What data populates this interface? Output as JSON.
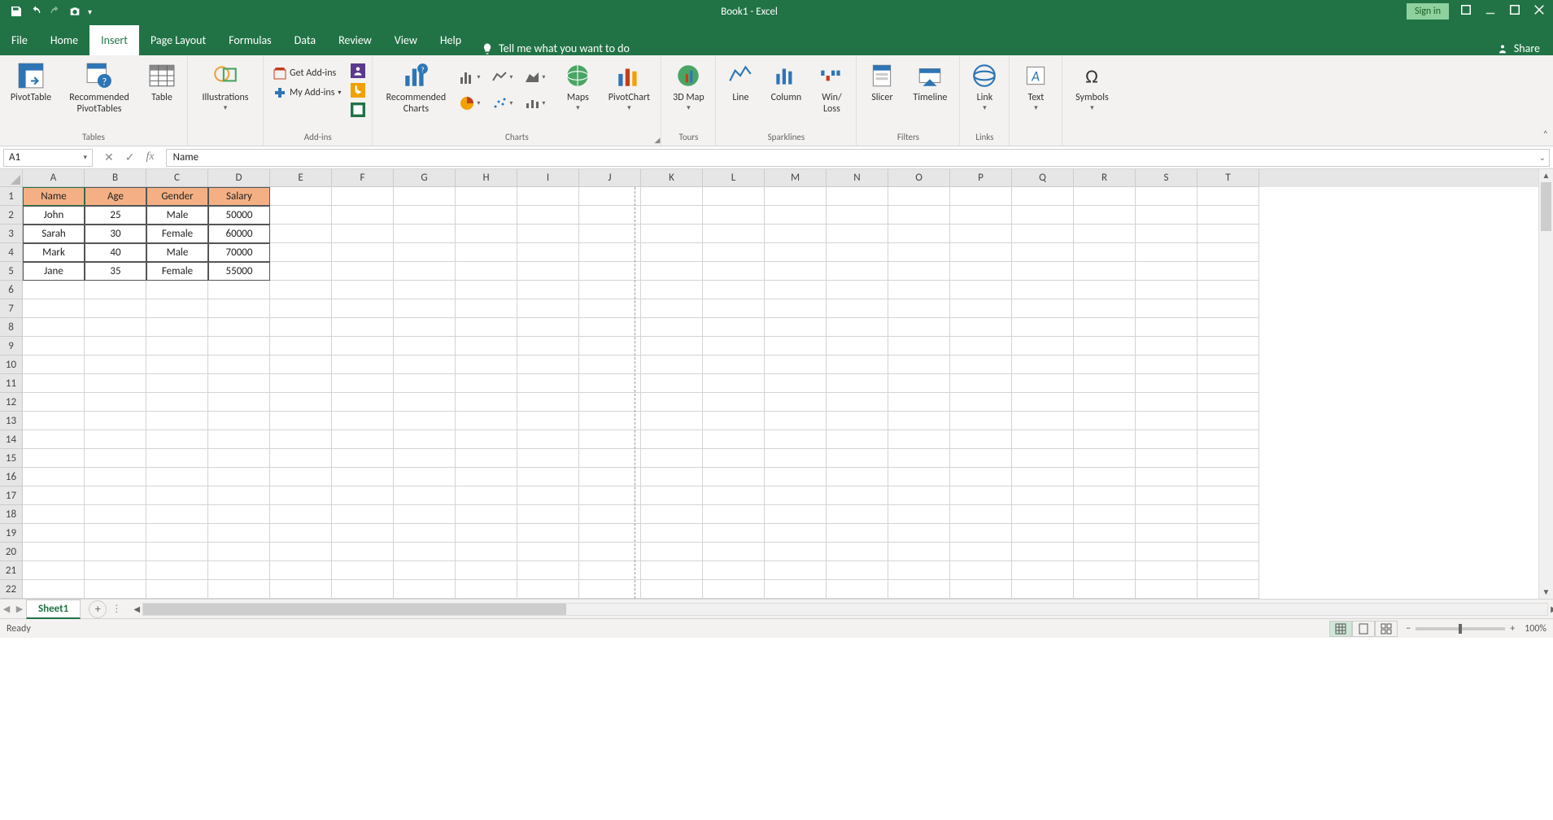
{
  "titlebar": {
    "title": "Book1  -  Excel",
    "signin": "Sign in"
  },
  "tabs": {
    "file": "File",
    "home": "Home",
    "insert": "Insert",
    "pagelayout": "Page Layout",
    "formulas": "Formulas",
    "data": "Data",
    "review": "Review",
    "view": "View",
    "help": "Help",
    "tellme": "Tell me what you want to do",
    "share": "Share"
  },
  "ribbon": {
    "tables": {
      "label": "Tables",
      "pivot": "PivotTable",
      "recpivot": "Recommended PivotTables",
      "table": "Table"
    },
    "illustrations": {
      "label": "Illustrations",
      "btn": "Illustrations"
    },
    "addins": {
      "label": "Add-ins",
      "get": "Get Add-ins",
      "my": "My Add-ins"
    },
    "charts": {
      "label": "Charts",
      "rec": "Recommended Charts",
      "maps": "Maps",
      "pivotchart": "PivotChart"
    },
    "tours": {
      "label": "Tours",
      "map": "3D Map"
    },
    "spark": {
      "label": "Sparklines",
      "line": "Line",
      "column": "Column",
      "winloss": "Win/\nLoss"
    },
    "filters": {
      "label": "Filters",
      "slicer": "Slicer",
      "timeline": "Timeline"
    },
    "links": {
      "label": "Links",
      "link": "Link"
    },
    "text": {
      "label": "Text",
      "btn": "Text"
    },
    "symbols": {
      "label": "Symbols",
      "btn": "Symbols"
    }
  },
  "namebox": "A1",
  "formula": "Name",
  "columns": [
    "A",
    "B",
    "C",
    "D",
    "E",
    "F",
    "G",
    "H",
    "I",
    "J",
    "K",
    "L",
    "M",
    "N",
    "O",
    "P",
    "Q",
    "R",
    "S",
    "T"
  ],
  "rowcount": 22,
  "sheet": {
    "headers": [
      "Name",
      "Age",
      "Gender",
      "Salary"
    ],
    "rows": [
      {
        "name": "John",
        "age": "25",
        "gender": "Male",
        "salary": "50000"
      },
      {
        "name": "Sarah",
        "age": "30",
        "gender": "Female",
        "salary": "60000"
      },
      {
        "name": "Mark",
        "age": "40",
        "gender": "Male",
        "salary": "70000"
      },
      {
        "name": "Jane",
        "age": "35",
        "gender": "Female",
        "salary": "55000"
      }
    ]
  },
  "sheettab": "Sheet1",
  "status": {
    "ready": "Ready",
    "zoom": "100%"
  }
}
